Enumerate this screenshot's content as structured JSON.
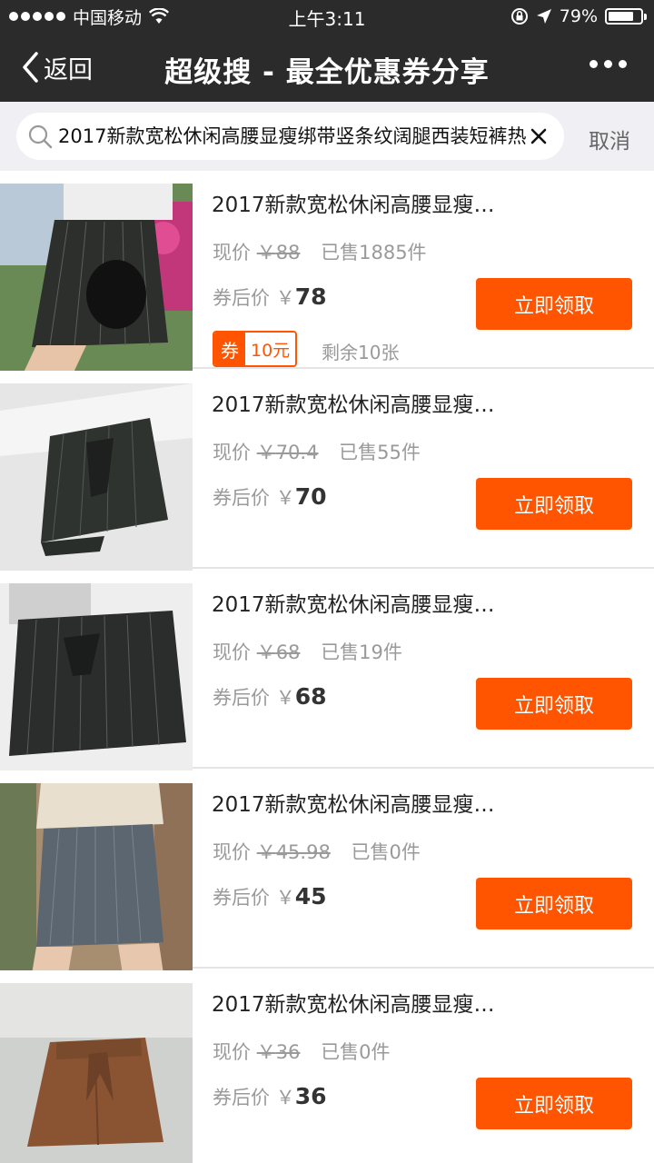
{
  "status_bar": {
    "carrier": "中国移动",
    "time": "上午3:11",
    "battery_text": "79%",
    "battery_level": 0.79,
    "icons": [
      "signal-dots-icon",
      "wifi-icon",
      "lock-rotation-icon",
      "location-arrow-icon",
      "battery-icon"
    ]
  },
  "nav": {
    "back_label": "返回",
    "title": "超级搜 - 最全优惠券分享",
    "more_icon": "more-dots-icon"
  },
  "search": {
    "query": "2017新款宽松休闲高腰显瘦绑带竖条纹阔腿西装短裤热",
    "clear_icon": "close-icon",
    "cancel_label": "取消"
  },
  "labels": {
    "now_price": "现价",
    "currency": "￥",
    "after_coupon": "券后价",
    "claim": "立即领取",
    "coupon_tag": "券"
  },
  "products": [
    {
      "title": "2017新款宽松休闲高腰显瘦…",
      "old_price": "88",
      "sold": "已售1885件",
      "after_price": "78",
      "coupon_value": "10元",
      "remaining": "剩余10张"
    },
    {
      "title": "2017新款宽松休闲高腰显瘦…",
      "old_price": "70.4",
      "sold": "已售55件",
      "after_price": "70"
    },
    {
      "title": "2017新款宽松休闲高腰显瘦…",
      "old_price": "68",
      "sold": "已售19件",
      "after_price": "68"
    },
    {
      "title": "2017新款宽松休闲高腰显瘦…",
      "old_price": "45.98",
      "sold": "已售0件",
      "after_price": "45"
    },
    {
      "title": "2017新款宽松休闲高腰显瘦…",
      "old_price": "36",
      "sold": "已售0件",
      "after_price": "36"
    }
  ],
  "colors": {
    "accent": "#ff5500",
    "header_bg": "#2b2b2b",
    "search_bg": "#efeff4"
  }
}
